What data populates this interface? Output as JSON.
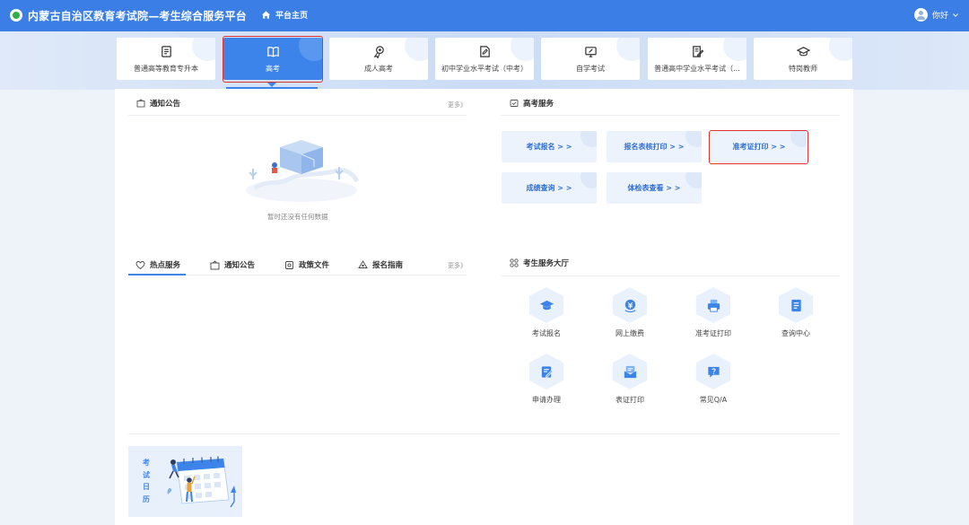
{
  "header": {
    "site_title": "内蒙古自治区教育考试院—考生综合服务平台",
    "home_label": "平台主页",
    "user_label": "你好"
  },
  "categories": [
    {
      "label": "普通高等教育专升本",
      "icon": "document-icon"
    },
    {
      "label": "高考",
      "icon": "open-book-icon",
      "active": true
    },
    {
      "label": "成人高考",
      "icon": "medal-icon"
    },
    {
      "label": "初中学业水平考试（中考）",
      "icon": "edit-doc-icon"
    },
    {
      "label": "自学考试",
      "icon": "monitor-pen-icon"
    },
    {
      "label": "普通高中学业水平考试（...",
      "icon": "pen-doc-icon"
    },
    {
      "label": "特岗教师",
      "icon": "graduation-cap-icon"
    }
  ],
  "notice": {
    "title": "通知公告",
    "more": "更多》",
    "empty_text": "暂时还没有任何数据"
  },
  "gaokao_service": {
    "title": "高考服务",
    "buttons": [
      {
        "label": "考试报名 > >"
      },
      {
        "label": "报名表核打印 > >"
      },
      {
        "label": "准考证打印 > >",
        "highlighted": true
      },
      {
        "label": "成绩查询 > >"
      },
      {
        "label": "体检表查看 > >"
      }
    ]
  },
  "info_tabs": {
    "items": [
      {
        "label": "热点服务",
        "icon": "heart-chat-icon",
        "active": true
      },
      {
        "label": "通知公告",
        "icon": "notice-icon"
      },
      {
        "label": "政策文件",
        "icon": "file-icon"
      },
      {
        "label": "报名指南",
        "icon": "guide-icon"
      }
    ],
    "more": "更多》"
  },
  "service_hall": {
    "title": "考生服务大厅",
    "items": [
      {
        "label": "考试报名",
        "icon": "graduation-cap-icon"
      },
      {
        "label": "网上缴费",
        "icon": "payment-icon"
      },
      {
        "label": "准考证打印",
        "icon": "printer-icon"
      },
      {
        "label": "查询中心",
        "icon": "document-search-icon"
      },
      {
        "label": "申请办理",
        "icon": "edit-form-icon"
      },
      {
        "label": "表证打印",
        "icon": "envelope-card-icon"
      },
      {
        "label": "常见Q/A",
        "icon": "question-bubble-icon"
      }
    ]
  },
  "calendar": {
    "chars": [
      "考",
      "试",
      "日",
      "历"
    ]
  },
  "colors": {
    "primary": "#3a7ee6",
    "highlight_border": "#e0322f",
    "panel_bg": "#ffffff",
    "page_bg": "#eef3fa"
  }
}
